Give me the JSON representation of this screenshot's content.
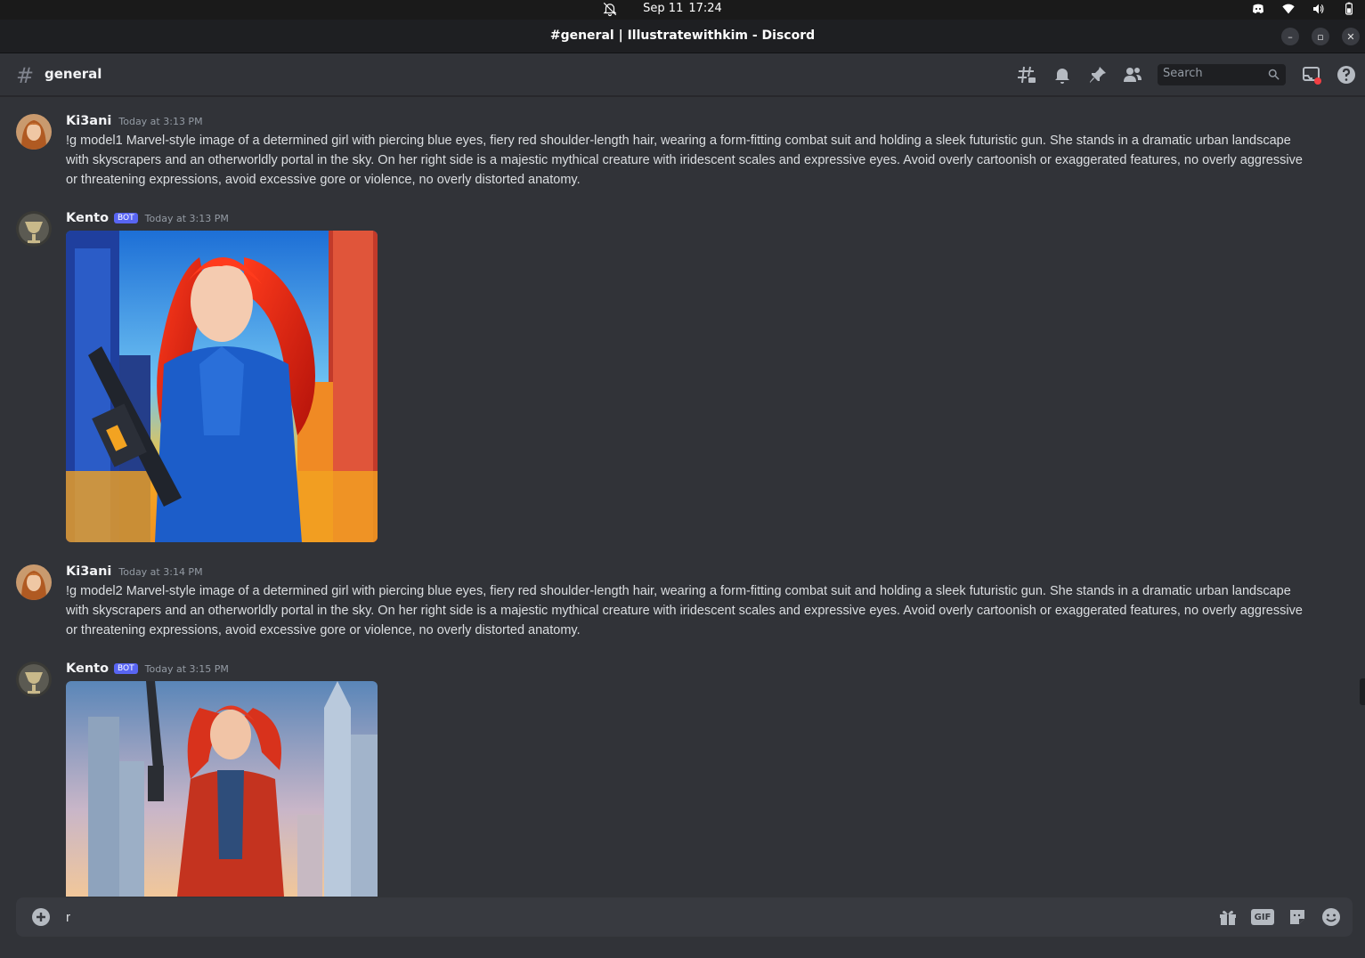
{
  "os": {
    "date": "Sep 11",
    "time": "17:24"
  },
  "window": {
    "title": "#general | Illustratewithkim - Discord"
  },
  "channel": {
    "hash": "#",
    "name": "general"
  },
  "search": {
    "placeholder": "Search"
  },
  "messages": [
    {
      "author": "Ki3ani",
      "timestamp": "Today at 3:13 PM",
      "text": "!g model1 Marvel-style image of a determined girl with piercing blue eyes, fiery red shoulder-length hair, wearing a form-fitting combat suit and holding a sleek futuristic gun. She stands in a dramatic urban landscape with skyscrapers and an otherworldly portal in the sky. On her right side is a majestic mythical creature with iridescent scales and expressive eyes. Avoid overly cartoonish or exaggerated features, no overly aggressive or threatening expressions, avoid excessive gore or violence, no overly distorted anatomy."
    },
    {
      "author": "Kento",
      "bot_tag": "BOT",
      "timestamp": "Today at 3:13 PM"
    },
    {
      "author": "Ki3ani",
      "timestamp": "Today at 3:14 PM",
      "text": "!g model2 Marvel-style image of a determined girl with piercing blue eyes, fiery red shoulder-length hair, wearing a form-fitting combat suit and holding a sleek futuristic gun. She stands in a dramatic urban landscape with skyscrapers and an otherworldly portal in the sky. On her right side is a majestic mythical creature with iridescent scales and expressive eyes. Avoid overly cartoonish or exaggerated features, no overly aggressive or threatening expressions, avoid excessive gore or violence, no overly distorted anatomy."
    },
    {
      "author": "Kento",
      "bot_tag": "BOT",
      "timestamp": "Today at 3:15 PM"
    }
  ],
  "composer": {
    "value": "r",
    "gif_label": "GIF"
  },
  "colors": {
    "background": "#313338",
    "sidebar_dark": "#1e1f22",
    "bot_tag": "#5865f2",
    "text": "#dbdee1"
  }
}
